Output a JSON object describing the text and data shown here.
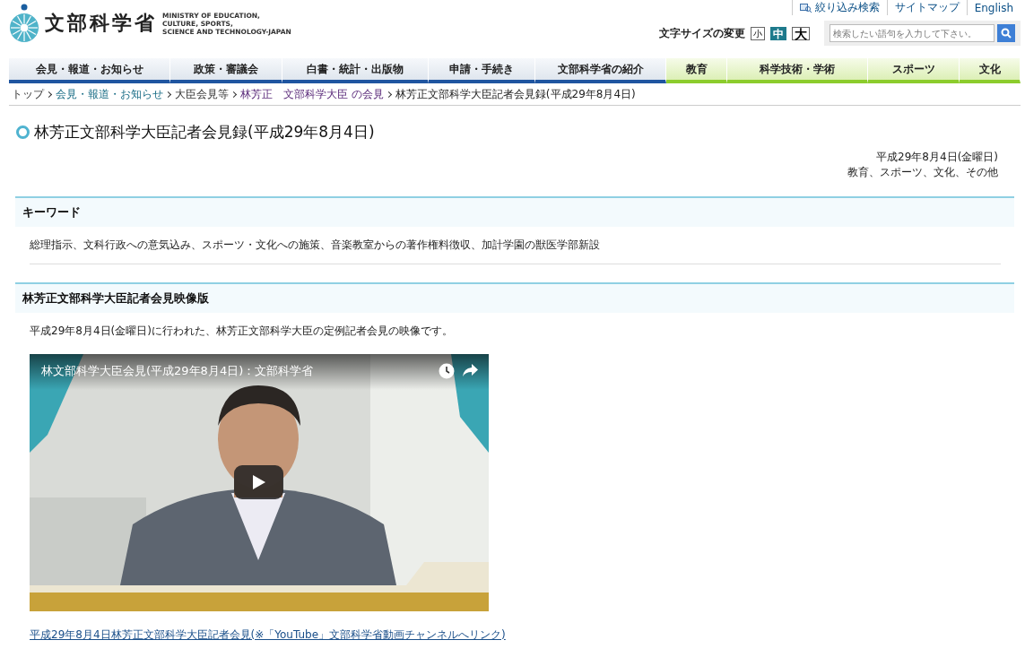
{
  "header": {
    "logo_text": "文部科学省",
    "logo_subtitle": [
      "MINISTRY OF EDUCATION,",
      "CULTURE, SPORTS,",
      "SCIENCE AND TECHNOLOGY-JAPAN"
    ],
    "utility_links": [
      "絞り込み検索",
      "サイトマップ",
      "English"
    ],
    "font_size_label": "文字サイズの変更",
    "font_sizes": [
      {
        "label": "小",
        "selected": false
      },
      {
        "label": "中",
        "selected": true
      },
      {
        "label": "大",
        "selected": false
      }
    ],
    "search": {
      "placeholder": "検索したい語句を入力して下さい。"
    }
  },
  "nav": [
    {
      "label": "会見・報道・お知らせ",
      "kind": "ministry"
    },
    {
      "label": "政策・審議会",
      "kind": "ministry"
    },
    {
      "label": "白書・統計・出版物",
      "kind": "ministry"
    },
    {
      "label": "申請・手続き",
      "kind": "ministry"
    },
    {
      "label": "文部科学省の紹介",
      "kind": "ministry"
    },
    {
      "label": "教育",
      "kind": "field"
    },
    {
      "label": "科学技術・学術",
      "kind": "field"
    },
    {
      "label": "スポーツ",
      "kind": "field"
    },
    {
      "label": "文化",
      "kind": "field"
    }
  ],
  "breadcrumb": [
    {
      "label": "トップ",
      "kind": "link"
    },
    {
      "label": "会見・報道・お知らせ",
      "kind": "link"
    },
    {
      "label": "大臣会見等",
      "kind": "link"
    },
    {
      "label": "林芳正　文部科学大臣 の会見",
      "kind": "link"
    },
    {
      "label": "林芳正文部科学大臣記者会見録(平成29年8月4日)",
      "kind": "current"
    }
  ],
  "page": {
    "title": "林芳正文部科学大臣記者会見録(平成29年8月4日)",
    "date": "平成29年8月4日(金曜日)",
    "categories": "教育、スポーツ、文化、その他"
  },
  "sections": [
    {
      "heading": "キーワード",
      "kind": "keywords",
      "text": "総理指示、文科行政への意気込み、スポーツ・文化への施策、音楽教室からの著作権料徴収、加計学園の獣医学部新設"
    },
    {
      "heading": "林芳正文部科学大臣記者会見映像版",
      "kind": "video",
      "text": "平成29年8月4日(金曜日)に行われた、林芳正文部科学大臣の定例記者会見の映像です。",
      "video": {
        "title": "林文部科学大臣会見(平成29年8月4日)：文部科学省",
        "kind": "picture"
      },
      "link": "平成29年8月4日林芳正文部科学大臣記者会見(※「YouTube」文部科学省動画チャンネルへリンク)"
    }
  ]
}
